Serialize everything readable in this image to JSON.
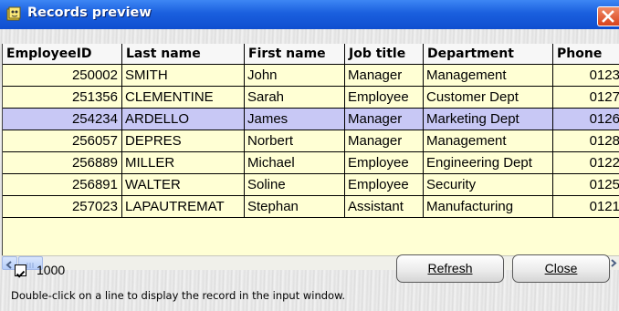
{
  "window": {
    "title": "Records preview"
  },
  "table": {
    "columns": [
      "EmployeeID",
      "Last name",
      "First name",
      "Job title",
      "Department",
      "Phone"
    ],
    "rows": [
      {
        "id": "250002",
        "last": "SMITH",
        "first": "John",
        "job": "Manager",
        "dept": "Management",
        "phone": "0123",
        "selected": false
      },
      {
        "id": "251356",
        "last": "CLEMENTINE",
        "first": "Sarah",
        "job": "Employee",
        "dept": "Customer Dept",
        "phone": "0127",
        "selected": false
      },
      {
        "id": "254234",
        "last": "ARDELLO",
        "first": "James",
        "job": "Manager",
        "dept": "Marketing Dept",
        "phone": "0126",
        "selected": true
      },
      {
        "id": "256057",
        "last": "DEPRES",
        "first": "Norbert",
        "job": "Manager",
        "dept": "Management",
        "phone": "0128",
        "selected": false
      },
      {
        "id": "256889",
        "last": "MILLER",
        "first": "Michael",
        "job": "Employee",
        "dept": "Engineering Dept",
        "phone": "0122",
        "selected": false
      },
      {
        "id": "256891",
        "last": "WALTER",
        "first": "Soline",
        "job": "Employee",
        "dept": "Security",
        "phone": "0125",
        "selected": false
      },
      {
        "id": "257023",
        "last": "LAPAUTREMAT",
        "first": "Stephan",
        "job": "Assistant",
        "dept": "Manufacturing",
        "phone": "0121",
        "selected": false
      }
    ]
  },
  "footer": {
    "limit_checked": true,
    "limit_value": "1000",
    "refresh_label": "Refresh",
    "close_label": "Close",
    "hint": "Double-click on a line to display the record in the input window."
  },
  "icons": {
    "title_icon": "app-icon",
    "close": "close-icon",
    "scroll_left": "chevron-left-icon",
    "scroll_right": "chevron-right-icon",
    "checkbox": "checkmark-icon"
  },
  "colors": {
    "title_bar": "#1a5fde",
    "grid_background": "#ffffd4",
    "selected_row": "#c8c8f5",
    "close_button": "#e05a2c"
  }
}
